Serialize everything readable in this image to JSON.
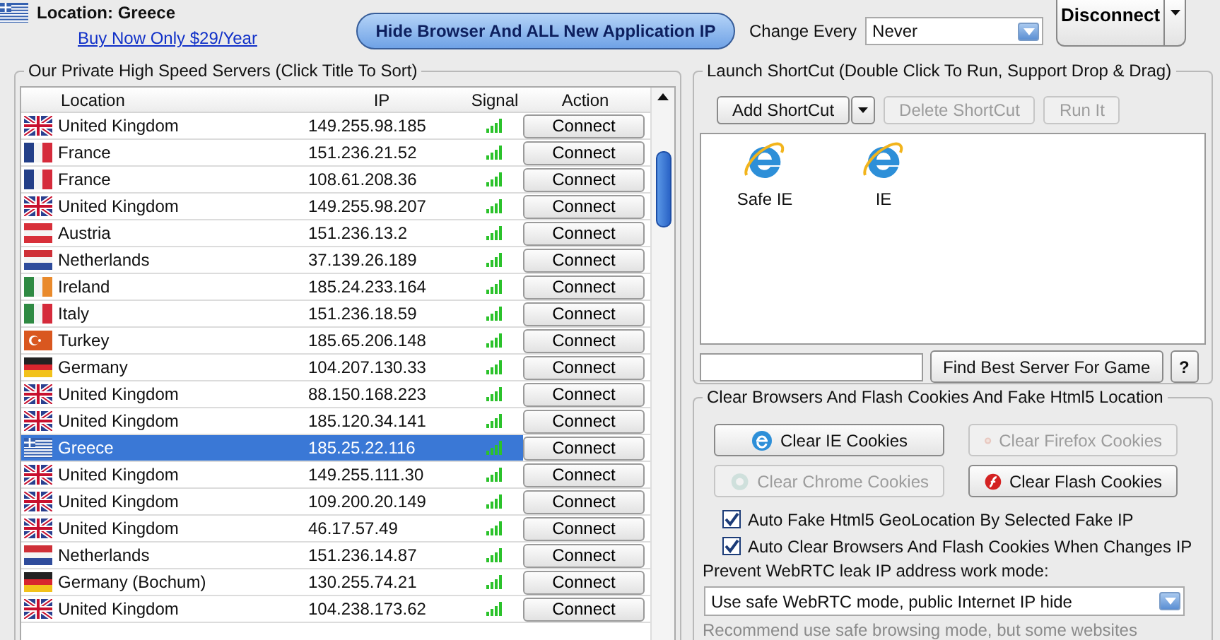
{
  "top": {
    "location": "Location: Greece",
    "buy_link": "Buy Now Only $29/Year",
    "hide_button": "Hide Browser And ALL New Application IP",
    "change_label": "Change Every",
    "change_value": "Never",
    "disconnect": "Disconnect"
  },
  "servers": {
    "title": "Our Private High Speed Servers (Click Title To Sort)",
    "columns": [
      "Location",
      "IP",
      "Signal",
      "Action"
    ],
    "rows": [
      {
        "kind": "gb",
        "location": "United Kingdom",
        "ip": "149.255.98.185",
        "action": "Connect",
        "selected": false
      },
      {
        "kind": "fr",
        "location": "France",
        "ip": "151.236.21.52",
        "action": "Connect",
        "selected": false
      },
      {
        "kind": "fr",
        "location": "France",
        "ip": "108.61.208.36",
        "action": "Connect",
        "selected": false
      },
      {
        "kind": "gb",
        "location": "United Kingdom",
        "ip": "149.255.98.207",
        "action": "Connect",
        "selected": false
      },
      {
        "kind": "at",
        "location": "Austria",
        "ip": "151.236.13.2",
        "action": "Connect",
        "selected": false
      },
      {
        "kind": "nl",
        "location": "Netherlands",
        "ip": "37.139.26.189",
        "action": "Connect",
        "selected": false
      },
      {
        "kind": "ie",
        "location": "Ireland",
        "ip": "185.24.233.164",
        "action": "Connect",
        "selected": false
      },
      {
        "kind": "it",
        "location": "Italy",
        "ip": "151.236.18.59",
        "action": "Connect",
        "selected": false
      },
      {
        "kind": "tr",
        "location": "Turkey",
        "ip": "185.65.206.148",
        "action": "Connect",
        "selected": false
      },
      {
        "kind": "de",
        "location": "Germany",
        "ip": "104.207.130.33",
        "action": "Connect",
        "selected": false
      },
      {
        "kind": "gb",
        "location": "United Kingdom",
        "ip": "88.150.168.223",
        "action": "Connect",
        "selected": false
      },
      {
        "kind": "gb",
        "location": "United Kingdom",
        "ip": "185.120.34.141",
        "action": "Connect",
        "selected": false
      },
      {
        "kind": "gr",
        "location": "Greece",
        "ip": "185.25.22.116",
        "action": "Connect",
        "selected": true
      },
      {
        "kind": "gb",
        "location": "United Kingdom",
        "ip": "149.255.111.30",
        "action": "Connect",
        "selected": false
      },
      {
        "kind": "gb",
        "location": "United Kingdom",
        "ip": "109.200.20.149",
        "action": "Connect",
        "selected": false
      },
      {
        "kind": "gb",
        "location": "United Kingdom",
        "ip": "46.17.57.49",
        "action": "Connect",
        "selected": false
      },
      {
        "kind": "nl",
        "location": "Netherlands",
        "ip": "151.236.14.87",
        "action": "Connect",
        "selected": false
      },
      {
        "kind": "de",
        "location": "Germany (Bochum)",
        "ip": "130.255.74.21",
        "action": "Connect",
        "selected": false
      },
      {
        "kind": "gb",
        "location": "United Kingdom",
        "ip": "104.238.173.62",
        "action": "Connect",
        "selected": false
      }
    ]
  },
  "shortcuts": {
    "title": "Launch ShortCut (Double Click To Run, Support Drop & Drag)",
    "buttons": [
      {
        "label": "Add ShortCut",
        "disabled": false
      },
      {
        "label": "Delete ShortCut",
        "disabled": true
      },
      {
        "label": "Run It",
        "disabled": true
      }
    ],
    "items": [
      "Safe IE",
      "IE"
    ],
    "find_button": "Find Best Server For Game",
    "help_button": "?"
  },
  "cleaner": {
    "title": "Clear Browsers And Flash Cookies And Fake Html5 Location",
    "buttons": [
      {
        "kind": "ie",
        "label": "Clear IE Cookies",
        "disabled": false
      },
      {
        "kind": "firefox",
        "label": "Clear Firefox Cookies",
        "disabled": true
      },
      {
        "kind": "chrome",
        "label": "Clear Chrome Cookies",
        "disabled": true
      },
      {
        "kind": "flash",
        "label": "Clear Flash Cookies",
        "disabled": false
      }
    ],
    "options": [
      {
        "label": "Auto Fake Html5 GeoLocation By Selected Fake IP",
        "checked": true
      },
      {
        "label": "Auto Clear Browsers And Flash Cookies When Changes IP",
        "checked": true
      }
    ],
    "webrtc_label": "Prevent WebRTC leak IP address work mode:",
    "webrtc_value": "Use safe WebRTC mode, public Internet IP hide",
    "hint": "Recommend use safe browsing mode, but some websites"
  }
}
